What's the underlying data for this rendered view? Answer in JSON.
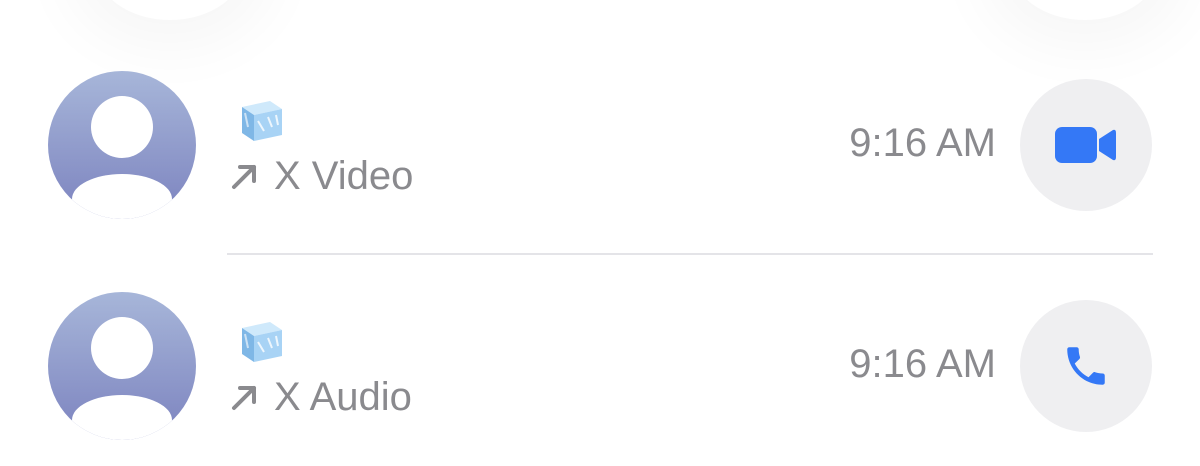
{
  "calls": [
    {
      "contact_emoji": "ice-cube-emoji",
      "type_label": "X Video",
      "direction_icon": "outgoing-arrow-icon",
      "time": "9:16 AM",
      "action_icon": "video-camera-icon"
    },
    {
      "contact_emoji": "ice-cube-emoji",
      "type_label": "X Audio",
      "direction_icon": "outgoing-arrow-icon",
      "time": "9:16 AM",
      "action_icon": "phone-icon"
    }
  ],
  "colors": {
    "accent": "#3478f6",
    "secondary_text": "#8a8a8e",
    "avatar_top": "#a7b6d9",
    "avatar_bottom": "#7c83bf",
    "button_bg": "#efeff1",
    "divider": "#e4e4e8"
  }
}
